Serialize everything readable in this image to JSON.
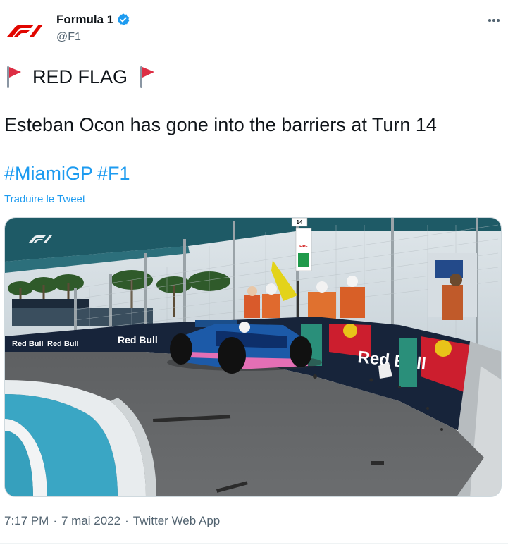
{
  "author": {
    "display_name": "Formula 1",
    "handle": "@F1",
    "avatar_icon": "f1-logo-icon",
    "verified_icon": "verified-badge-icon",
    "brand_color": "#e10600"
  },
  "menu": {
    "icon": "more-horizontal-icon"
  },
  "tweet": {
    "flag_icon": "triangular-flag-icon",
    "red_flag_text": "RED FLAG",
    "body": "Esteban Ocon has gone into the barriers at Turn 14",
    "hashtags": [
      "#MiamiGP",
      "#F1"
    ],
    "translate_label": "Traduire le Tweet"
  },
  "media": {
    "description_icon": "crash-photo",
    "overlay_logo": "f1-logo-icon",
    "turn_sign": "14",
    "fire_sign": "FIRE",
    "exit_sign": "EXIT",
    "barrier_brand": "Red Bull"
  },
  "meta": {
    "time": "7:17 PM",
    "date": "7 mai 2022",
    "separator": "·",
    "source": "Twitter Web App"
  },
  "colors": {
    "link": "#1d9bf0",
    "muted": "#536471",
    "text": "#0f1419"
  }
}
